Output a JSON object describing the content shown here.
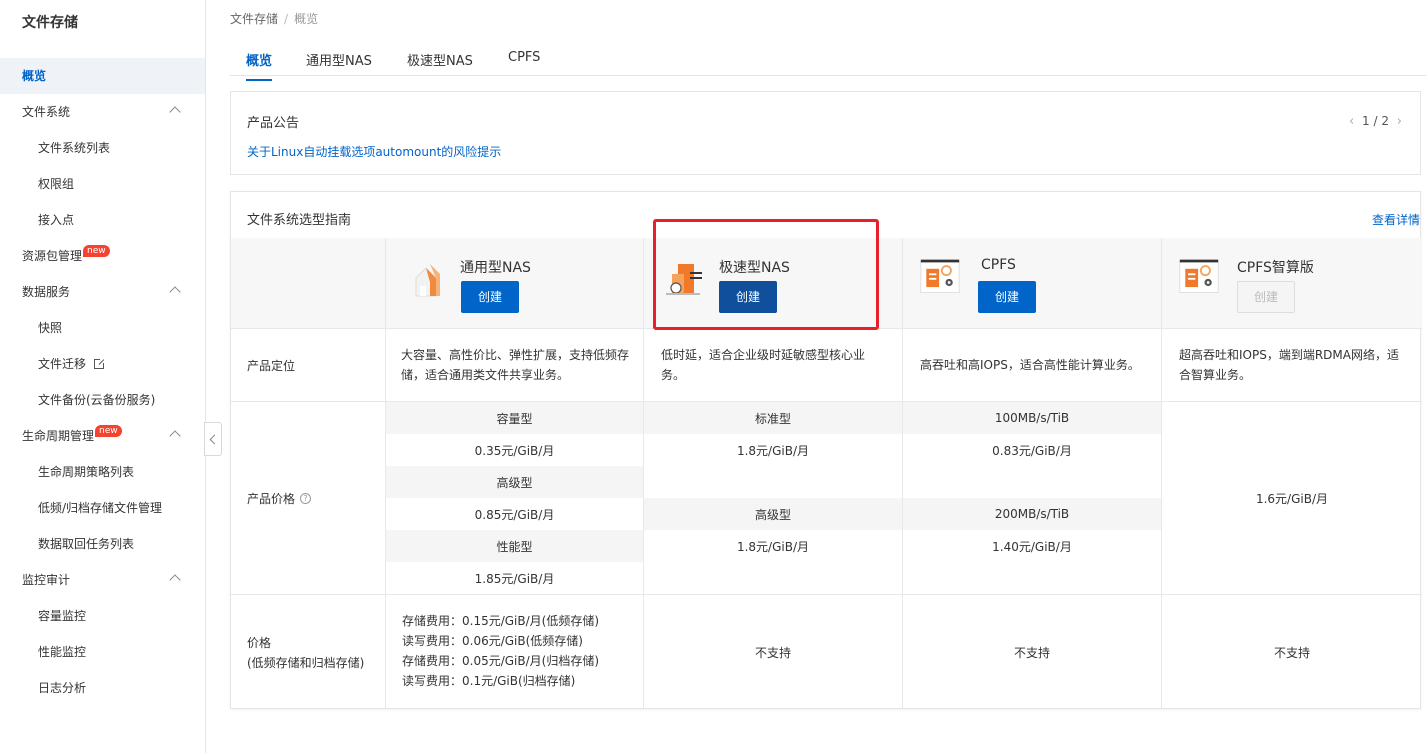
{
  "sidebar": {
    "title": "文件存储",
    "overview": "概览",
    "file_system": "文件系统",
    "file_system_list": "文件系统列表",
    "permission_group": "权限组",
    "mount_point": "接入点",
    "resource_pack": "资源包管理",
    "new_badge": "new",
    "data_service": "数据服务",
    "snapshot": "快照",
    "file_migration": "文件迁移",
    "file_backup": "文件备份(云备份服务)",
    "lifecycle": "生命周期管理",
    "lifecycle_policy": "生命周期策略列表",
    "low_freq_mgmt": "低频/归档存储文件管理",
    "retrieval_tasks": "数据取回任务列表",
    "monitor_audit": "监控审计",
    "capacity_monitor": "容量监控",
    "perf_monitor": "性能监控",
    "log_analysis": "日志分析"
  },
  "breadcrumb": {
    "root": "文件存储",
    "sep": "/",
    "current": "概览"
  },
  "tabs": [
    "概览",
    "通用型NAS",
    "极速型NAS",
    "CPFS"
  ],
  "notice": {
    "title": "产品公告",
    "link": "关于Linux自动挂载选项automount的风险提示",
    "pager": "1 / 2",
    "prev": "‹",
    "next": "›"
  },
  "guide": {
    "title": "文件系统选型指南",
    "more": "查看详情",
    "row_labels": {
      "positioning": "产品定位",
      "price": "产品价格",
      "help": "?",
      "price2": "价格",
      "price2_sub": "(低频存储和归档存储)"
    },
    "products": [
      {
        "name": "通用型NAS",
        "button": "创建",
        "positioning": "大容量、高性价比、弹性扩展，支持低频存储，适合通用类文件共享业务。",
        "tiers": [
          {
            "name": "容量型",
            "price": "0.35元/GiB/月"
          },
          {
            "name": "高级型",
            "price": "0.85元/GiB/月"
          },
          {
            "name": "性能型",
            "price": "1.85元/GiB/月"
          }
        ],
        "price2_lines": [
          "存储费用：0.15元/GiB/月(低频存储)",
          "读写费用：0.06元/GiB(低频存储)",
          "存储费用：0.05元/GiB/月(归档存储)",
          "读写费用：0.1元/GiB(归档存储)"
        ]
      },
      {
        "name": "极速型NAS",
        "button": "创建",
        "positioning": "低时延，适合企业级时延敏感型核心业务。",
        "tiers": [
          {
            "name": "标准型",
            "price": "1.8元/GiB/月"
          },
          {
            "name": "高级型",
            "price": "1.8元/GiB/月"
          }
        ],
        "price2": "不支持"
      },
      {
        "name": "CPFS",
        "button": "创建",
        "positioning": "高吞吐和高IOPS，适合高性能计算业务。",
        "tiers": [
          {
            "name": "100MB/s/TiB",
            "price": "0.83元/GiB/月"
          },
          {
            "name": "200MB/s/TiB",
            "price": "1.40元/GiB/月"
          }
        ],
        "price2": "不支持"
      },
      {
        "name": "CPFS智算版",
        "button": "创建",
        "positioning": "超高吞吐和IOPS，端到端RDMA网络，适合智算业务。",
        "price": "1.6元/GiB/月",
        "price2": "不支持"
      }
    ]
  },
  "colors": {
    "accent": "#0064c8",
    "highlight_border": "#e8202b",
    "badge": "#f5432f"
  }
}
